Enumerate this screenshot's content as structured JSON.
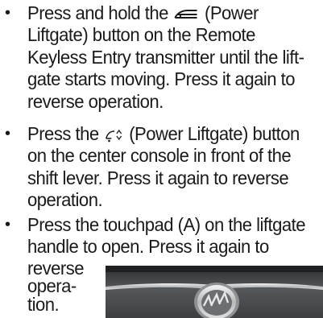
{
  "bullets": [
    {
      "marker": "•",
      "lines": [
        {
          "before": "Press and hold the ",
          "icon": "liftgate-remote-icon",
          "after": " (Power"
        },
        {
          "text": "Liftgate) button on the Remote"
        },
        {
          "text": "Keyless Entry transmitter until the lift-"
        },
        {
          "text": "gate starts moving. Press it again to"
        },
        {
          "text": "reverse operation."
        }
      ]
    },
    {
      "marker": "•",
      "lines": [
        {
          "before": "Press the ",
          "icon": "liftgate-console-icon",
          "after": " (Power Liftgate) button"
        },
        {
          "text": "on the center console in front of the"
        },
        {
          "text": "shift lever. Press it again to reverse"
        },
        {
          "text": "operation."
        }
      ]
    },
    {
      "marker": "•",
      "lines": [
        {
          "text": "Press the touchpad (A) on the liftgate"
        },
        {
          "text": "handle to open. Press it again to"
        },
        {
          "text": "reverse"
        },
        {
          "text": "opera-"
        },
        {
          "text": "tion."
        }
      ]
    }
  ],
  "photo": {
    "subject": "liftgate-emblem-photo",
    "colors": {
      "body": "#4a4d50",
      "chrome": "#c9c9c9",
      "highlight": "#efefef"
    }
  }
}
